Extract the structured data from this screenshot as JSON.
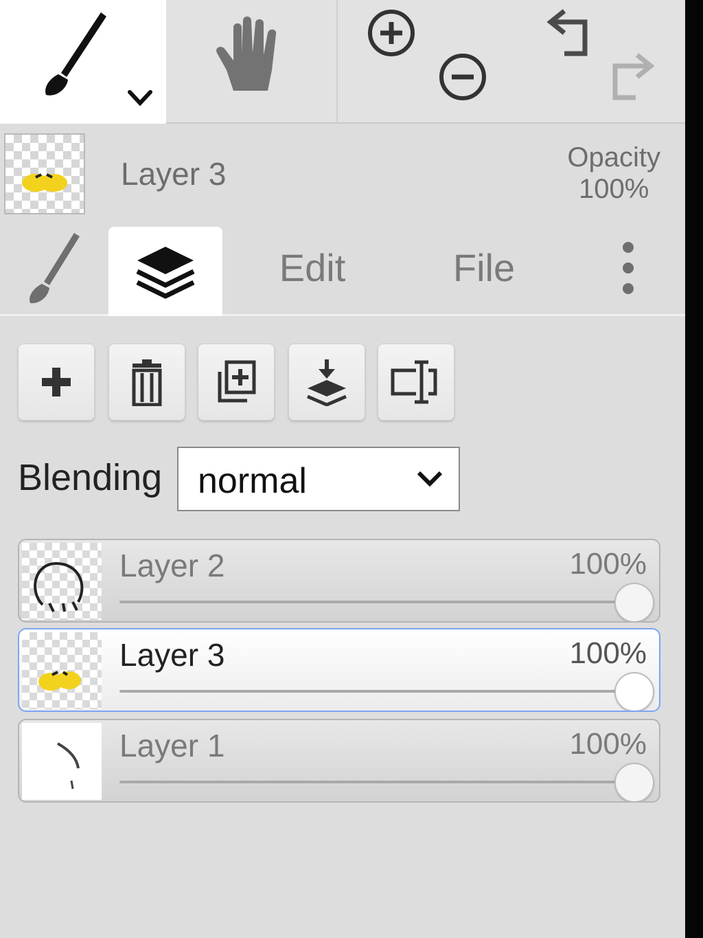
{
  "toolbar": {
    "tools": [
      {
        "icon": "paintbrush-icon",
        "active": true
      },
      {
        "icon": "hand-icon",
        "active": false
      }
    ],
    "zoom": [
      "zoom-in-icon",
      "zoom-out-icon"
    ],
    "history": [
      "undo-icon",
      "redo-icon"
    ]
  },
  "current_layer": {
    "name": "Layer 3",
    "opacity_label": "Opacity",
    "opacity_value": "100%"
  },
  "tabs": [
    {
      "icon": "paintbrush-icon"
    },
    {
      "icon": "layers-icon",
      "active": true
    },
    {
      "label": "Edit"
    },
    {
      "label": "File"
    },
    {
      "icon": "more-vertical-icon"
    }
  ],
  "layer_actions": [
    "add-icon",
    "trash-icon",
    "duplicate-icon",
    "merge-down-icon",
    "rename-icon"
  ],
  "blending": {
    "label": "Blending",
    "value": "normal"
  },
  "layers": [
    {
      "name": "Layer 2",
      "opacity": "100%",
      "opacity_fraction": 1.0,
      "active": false
    },
    {
      "name": "Layer 3",
      "opacity": "100%",
      "opacity_fraction": 1.0,
      "active": true
    },
    {
      "name": "Layer 1",
      "opacity": "100%",
      "opacity_fraction": 1.0,
      "active": false
    }
  ],
  "colors": {
    "active_border": "#7ea6f0",
    "thumb_yellow": "#f2d21c"
  }
}
